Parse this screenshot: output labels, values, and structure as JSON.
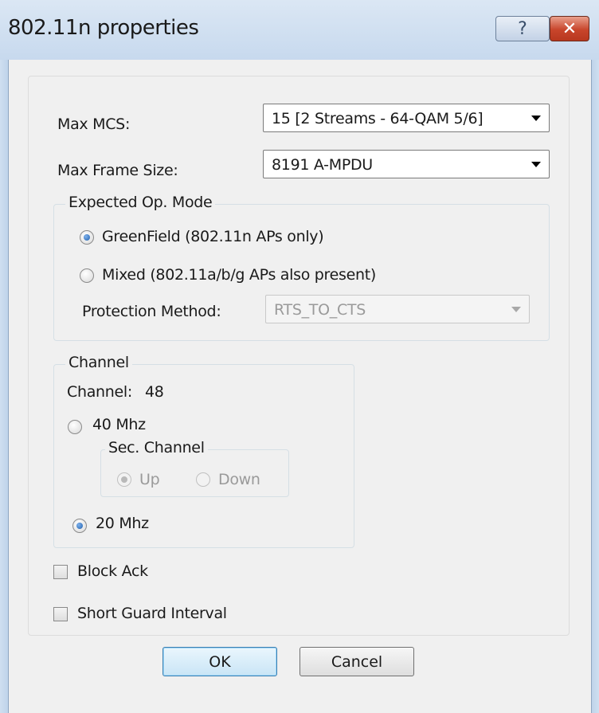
{
  "window": {
    "title": "802.11n properties",
    "help_glyph": "?",
    "close_glyph": "✕"
  },
  "max_mcs": {
    "label": "Max MCS:",
    "value": "15 [2 Streams - 64-QAM 5/6]"
  },
  "max_frame_size": {
    "label": "Max Frame Size:",
    "value": "8191  A-MPDU"
  },
  "expected_op_mode": {
    "title": "Expected Op. Mode",
    "greenfield_label": "GreenField (802.11n APs only)",
    "greenfield_checked": true,
    "mixed_label": "Mixed (802.11a/b/g APs also present)",
    "mixed_checked": false,
    "protection_label": "Protection Method:",
    "protection_value": "RTS_TO_CTS",
    "protection_enabled": false
  },
  "channel": {
    "title": "Channel",
    "channel_label": "Channel:",
    "channel_value": "48",
    "mhz40_label": "40 Mhz",
    "mhz40_checked": false,
    "sec_channel_title": "Sec. Channel",
    "up_label": "Up",
    "up_checked": true,
    "down_label": "Down",
    "down_checked": false,
    "sec_enabled": false,
    "mhz20_label": "20 Mhz",
    "mhz20_checked": true
  },
  "block_ack": {
    "label": "Block Ack",
    "checked": false
  },
  "short_guard": {
    "label": "Short Guard Interval",
    "checked": false
  },
  "buttons": {
    "ok": "OK",
    "cancel": "Cancel"
  }
}
